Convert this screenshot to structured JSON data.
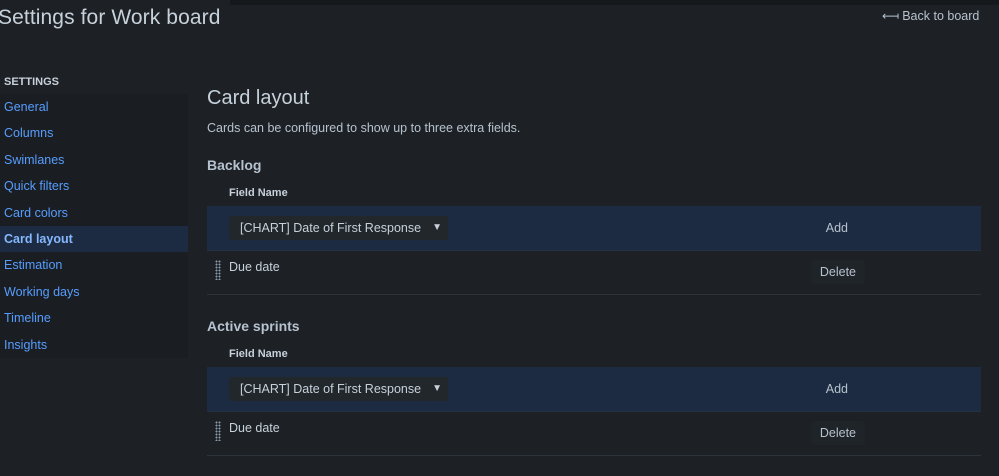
{
  "header": {
    "title": "Settings for Work board",
    "back_label": "Back to board",
    "back_icon": "arrow-left-icon"
  },
  "sidebar": {
    "heading": "SETTINGS",
    "items": [
      {
        "label": "General"
      },
      {
        "label": "Columns"
      },
      {
        "label": "Swimlanes"
      },
      {
        "label": "Quick filters"
      },
      {
        "label": "Card colors"
      },
      {
        "label": "Card layout",
        "active": true
      },
      {
        "label": "Estimation"
      },
      {
        "label": "Working days"
      },
      {
        "label": "Timeline"
      },
      {
        "label": "Insights"
      }
    ]
  },
  "main": {
    "title": "Card layout",
    "description": "Cards can be configured to show up to three extra fields.",
    "sections": {
      "backlog": {
        "title": "Backlog",
        "field_header": "Field Name",
        "select_value": "[CHART] Date of First Response",
        "add_label": "Add",
        "fields": [
          {
            "name": "Due date",
            "action": "Delete"
          }
        ]
      },
      "sprints": {
        "title": "Active sprints",
        "field_header": "Field Name",
        "select_value": "[CHART] Date of First Response",
        "add_label": "Add",
        "fields": [
          {
            "name": "Due date",
            "action": "Delete"
          }
        ]
      }
    }
  },
  "colors": {
    "background": "#1d2125",
    "link": "#579dff",
    "active_row": "#1c2b41"
  }
}
